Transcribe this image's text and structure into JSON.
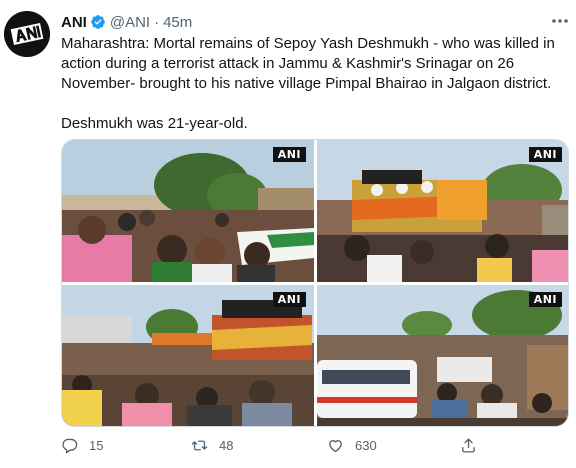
{
  "tweet": {
    "author": {
      "display_name": "ANI",
      "handle": "@ANI",
      "verified": true,
      "avatar_icon": "ani-logo-icon"
    },
    "separator": "·",
    "timestamp": "45m",
    "text": [
      "Maharashtra: Mortal remains of Sepoy Yash Deshmukh - who was killed in action during a terrorist attack in Jammu & Kashmir's Srinagar on 26 November- brought to his native village Pimpal Bhairao in Jalgaon district.",
      "Deshmukh was 21-year-old."
    ],
    "media": [
      {
        "watermark": "ANI"
      },
      {
        "watermark": "ANI"
      },
      {
        "watermark": "ANI"
      },
      {
        "watermark": "ANI"
      }
    ],
    "actions": {
      "reply_count": "15",
      "retweet_count": "48",
      "like_count": "630"
    },
    "colors": {
      "text": "#0f1419",
      "secondary": "#536471",
      "verified": "#1d9bf0",
      "border": "#cfd9de"
    }
  }
}
